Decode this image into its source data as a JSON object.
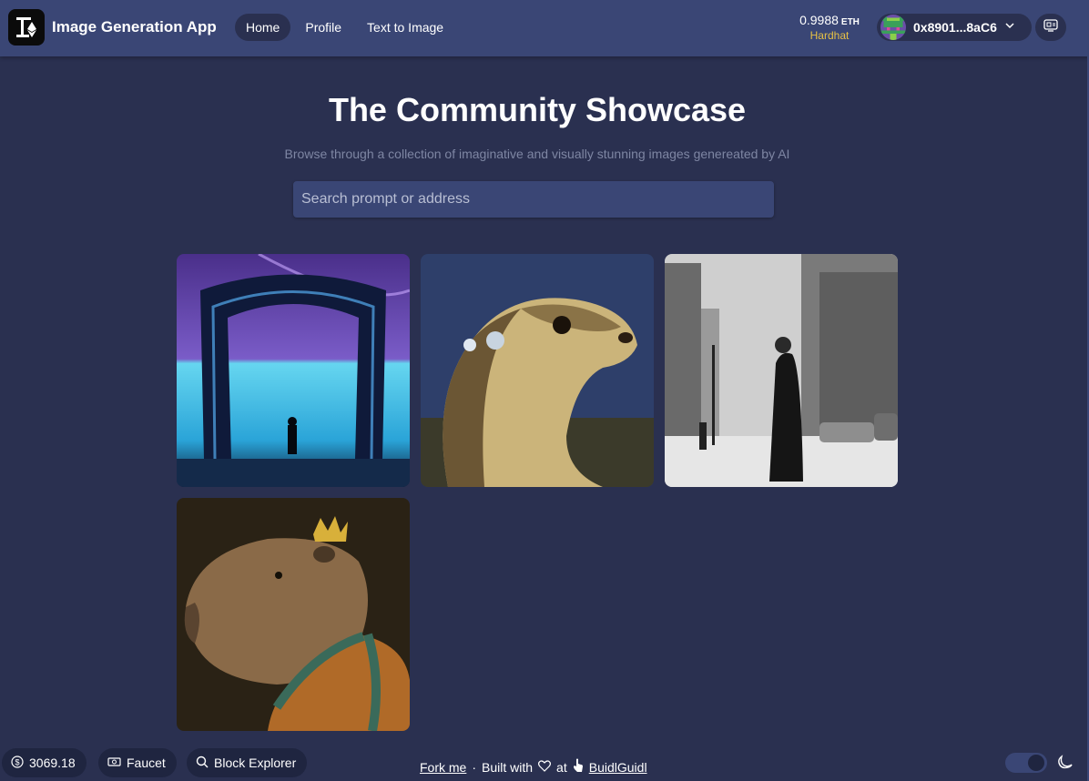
{
  "header": {
    "app_title": "Image Generation App",
    "logo_icon": "scaffold-logo-icon",
    "nav": [
      {
        "label": "Home",
        "active": true
      },
      {
        "label": "Profile",
        "active": false
      },
      {
        "label": "Text to Image",
        "active": false
      }
    ],
    "balance": {
      "amount": "0.9988",
      "unit": "ETH",
      "network": "Hardhat"
    },
    "account": {
      "address": "0x8901...8aC6",
      "avatar_icon": "blockie-avatar-icon"
    },
    "qr_icon": "qr-code-icon"
  },
  "hero": {
    "title": "The Community Showcase",
    "subtitle": "Browse through a collection of imaginative and visually stunning images genereated by AI"
  },
  "search": {
    "placeholder": "Search prompt or address",
    "value": ""
  },
  "gallery": [
    {
      "subject": "portal-figure-image"
    },
    {
      "subject": "otter-pearl-earring-image"
    },
    {
      "subject": "bw-city-street-image"
    },
    {
      "subject": "capybara-king-image"
    }
  ],
  "footer": {
    "price": "3069.18",
    "faucet_label": "Faucet",
    "explorer_label": "Block Explorer",
    "fork_me": "Fork me",
    "separator": "·",
    "built_with": "Built with",
    "at": "at",
    "buidl": "BuidlGuidl",
    "theme": "dark"
  },
  "colors": {
    "background": "#2a3050",
    "header": "#3a4675",
    "accent_yellow": "#e6c045",
    "pill": "#1f2540"
  }
}
